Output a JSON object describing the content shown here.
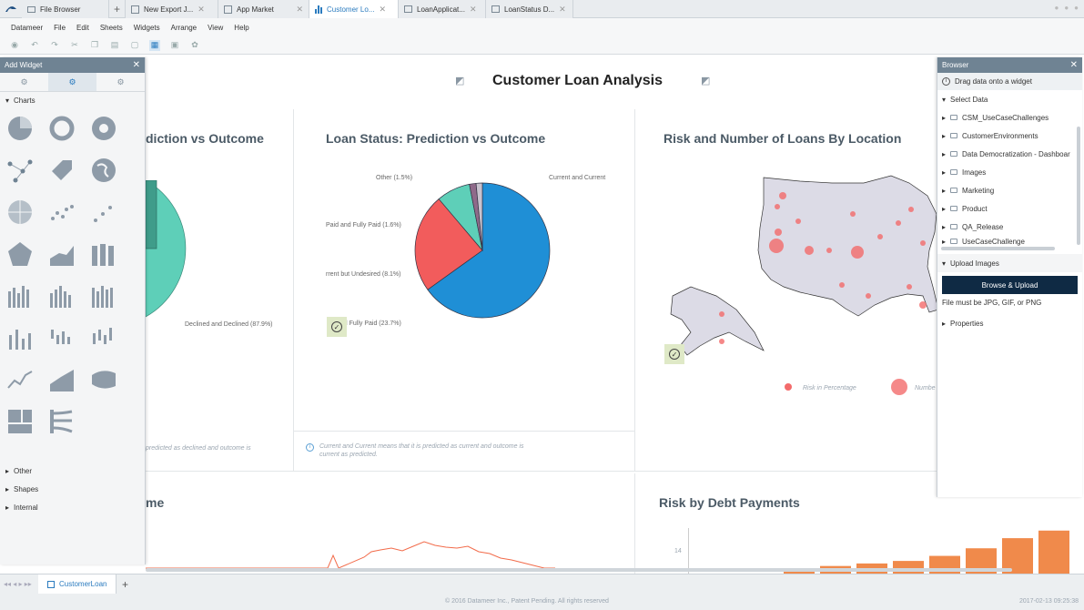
{
  "tabs": [
    {
      "label": "File Browser",
      "icon": "folder-icon"
    },
    {
      "label": "New Export J...",
      "icon": "export-icon"
    },
    {
      "label": "App Market",
      "icon": "app-icon"
    },
    {
      "label": "Customer Lo...",
      "icon": "chart-icon",
      "active": true
    },
    {
      "label": "LoanApplicat...",
      "icon": "sheet-icon"
    },
    {
      "label": "LoanStatus D...",
      "icon": "sheet-icon"
    }
  ],
  "menu": [
    "Datameer",
    "File",
    "Edit",
    "Sheets",
    "Widgets",
    "Arrange",
    "View",
    "Help"
  ],
  "dashboard": {
    "title": "Customer Loan Analysis",
    "panel1": {
      "title": "diction vs Outcome",
      "label_declined": "Declined and Declined (87.9%)",
      "note": "predicted as declined and outcome is"
    },
    "panel2": {
      "title": "Loan Status: Prediction vs Outcome",
      "labels": {
        "other": "Other (1.5%)",
        "current": "Current and Current",
        "paid": "Paid and Fully Paid (1.6%)",
        "undesired": "rrent but Undesired (8.1%)",
        "fully": "and Fully Paid (23.7%)"
      },
      "note": "Current and Current means that it is predicted as current and outcome is current as predicted."
    },
    "panel3": {
      "title": "Risk and Number of Loans By Location",
      "legend_risk": "Risk in Percentage",
      "legend_number": "Numbe"
    },
    "panel4": {
      "title": "me"
    },
    "panel5": {
      "title": "Risk by Debt Payments",
      "ytick": "14"
    }
  },
  "add_widget": {
    "title": "Add Widget",
    "section_charts": "Charts",
    "section_other": "Other",
    "section_shapes": "Shapes",
    "section_internal": "Internal"
  },
  "browser": {
    "title": "Browser",
    "drag_hint": "Drag data onto a widget",
    "select_data": "Select Data",
    "folders": [
      "CSM_UseCaseChallenges",
      "CustomerEnvironments",
      "Data Democratization - Dashboar",
      "Images",
      "Marketing",
      "Product",
      "QA_Release",
      "UseCaseChallenge"
    ],
    "upload_images": "Upload Images",
    "upload_button": "Browse & Upload",
    "upload_hint": "File must be JPG, GIF, or PNG",
    "properties": "Properties"
  },
  "sheet_tab": "CustomerLoan",
  "footer": {
    "copyright": "© 2016 Datameer Inc., Patent Pending. All rights reserved",
    "timestamp": "2017-02-13 09:25:38"
  },
  "chart_data": [
    {
      "type": "pie",
      "title": "Loan Status: Prediction vs Outcome",
      "categories": [
        "Current and Current",
        "Fully Paid and Fully Paid",
        "Current but Undesired",
        "Paid and Fully Paid",
        "Other"
      ],
      "values": [
        65.1,
        23.7,
        8.1,
        1.6,
        1.5
      ],
      "colors": [
        "#1f8fd6",
        "#f25c5c",
        "#5ecfb8",
        "#8f6a8a",
        "#c9c3cf"
      ]
    },
    {
      "type": "bar",
      "title": "Risk by Debt Payments",
      "values": [
        11,
        11.5,
        12,
        12.5,
        13.5,
        15,
        17,
        18.5
      ],
      "colors": [
        "#f08a4b"
      ]
    }
  ]
}
